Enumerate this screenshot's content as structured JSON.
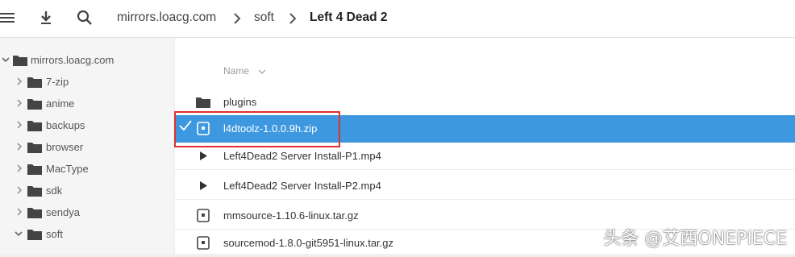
{
  "breadcrumb": [
    "mirrors.loacg.com",
    "soft",
    "Left 4 Dead 2"
  ],
  "sidebar": {
    "root": "mirrors.loacg.com",
    "items": [
      "7-zip",
      "anime",
      "backups",
      "browser",
      "MacType",
      "sdk",
      "sendya",
      "soft"
    ]
  },
  "list": {
    "header": "Name",
    "rows": [
      {
        "name": "plugins",
        "icon": "folder-icon"
      },
      {
        "name": "l4dtoolz-1.0.0.9h.zip",
        "icon": "archive-icon"
      },
      {
        "name": "Left4Dead2 Server Install-P1.mp4",
        "icon": "play-icon"
      },
      {
        "name": "Left4Dead2 Server Install-P2.mp4",
        "icon": "play-icon"
      },
      {
        "name": "mmsource-1.10.6-linux.tar.gz",
        "icon": "archive-icon"
      },
      {
        "name": "sourcemod-1.8.0-git5951-linux.tar.gz",
        "icon": "archive-icon"
      }
    ]
  },
  "watermark": "头条 @艾西ONEPIECE",
  "colors": {
    "selection": "#3d98e0",
    "highlight": "#e0302f"
  }
}
